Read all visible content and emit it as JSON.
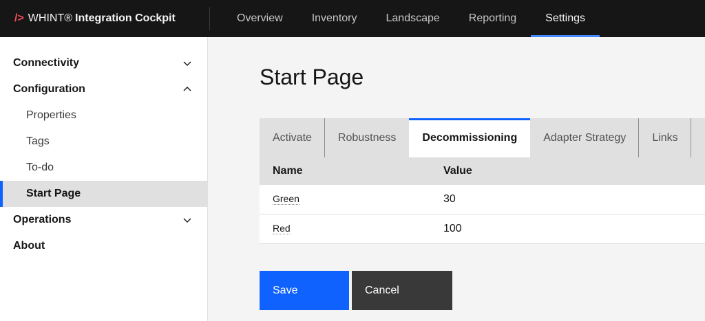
{
  "header": {
    "brand_slash": "/>",
    "brand_name": "WHINT®",
    "brand_product": "Integration Cockpit",
    "nav": [
      {
        "label": "Overview"
      },
      {
        "label": "Inventory"
      },
      {
        "label": "Landscape"
      },
      {
        "label": "Reporting"
      },
      {
        "label": "Settings",
        "active": true
      }
    ]
  },
  "sidebar": {
    "sections": [
      {
        "label": "Connectivity",
        "expanded": false
      },
      {
        "label": "Configuration",
        "expanded": true,
        "children": [
          "Properties",
          "Tags",
          "To-do",
          "Start Page"
        ],
        "active_child": "Start Page"
      },
      {
        "label": "Operations",
        "expanded": false
      },
      {
        "label": "About"
      }
    ]
  },
  "main": {
    "title": "Start Page",
    "tabs": [
      {
        "label": "Activate"
      },
      {
        "label": "Robustness"
      },
      {
        "label": "Decommissioning",
        "active": true
      },
      {
        "label": "Adapter Strategy"
      },
      {
        "label": "Links"
      }
    ],
    "table": {
      "headers": {
        "name": "Name",
        "value": "Value"
      },
      "rows": [
        {
          "name": "Green",
          "value": "30"
        },
        {
          "name": "Red",
          "value": "100"
        }
      ]
    },
    "buttons": {
      "save": "Save",
      "cancel": "Cancel"
    }
  },
  "colors": {
    "header_bg": "#161616",
    "accent": "#0f62fe",
    "brand_slash": "#fa4d56",
    "cancel_bg": "#393939"
  }
}
